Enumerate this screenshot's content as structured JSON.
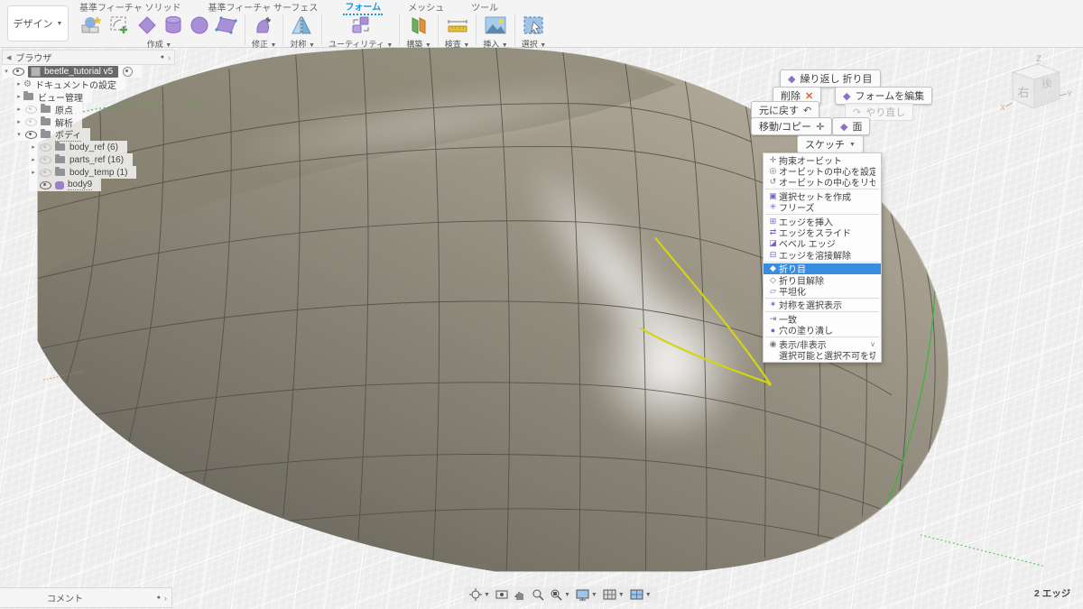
{
  "header": {
    "design_button": "デザイン",
    "tabs": [
      {
        "label": "基準フィーチャ ソリッド"
      },
      {
        "label": "基準フィーチャ サーフェス"
      },
      {
        "label": "フォーム"
      },
      {
        "label": "メッシュ"
      },
      {
        "label": "ツール"
      }
    ],
    "active_tab": "フォーム",
    "groups": [
      {
        "label": "作成"
      },
      {
        "label": "修正"
      },
      {
        "label": "対称"
      },
      {
        "label": "ユーティリティ"
      },
      {
        "label": "構築"
      },
      {
        "label": "検査"
      },
      {
        "label": "挿入"
      },
      {
        "label": "選択"
      }
    ]
  },
  "browser": {
    "title": "ブラウザ",
    "rows": [
      {
        "label": "beetle_tutorial v5"
      },
      {
        "label": "ドキュメントの設定"
      },
      {
        "label": "ビュー管理"
      },
      {
        "label": "原点"
      },
      {
        "label": "解析"
      },
      {
        "label": "ボディ"
      },
      {
        "label": "body_ref (6)"
      },
      {
        "label": "parts_ref (16)"
      },
      {
        "label": "body_temp (1)"
      },
      {
        "label": "body9"
      }
    ]
  },
  "marking_menu": {
    "repeat_crease": "繰り返し 折り目",
    "repeat_icon": "◆",
    "delete": "削除",
    "delete_icon": "✕",
    "edit_form": "フォームを編集",
    "edit_form_icon": "◆",
    "undo": "元に戻す",
    "undo_icon": "↶",
    "redo": "やり直し",
    "redo_icon": "↷",
    "move_copy": "移動/コピー",
    "move_icon": "✛",
    "face": "面",
    "face_icon": "◆",
    "sketch": "スケッチ"
  },
  "context_menu": {
    "items": [
      {
        "label": "拘束オービット",
        "glyph": "✛"
      },
      {
        "label": "オービットの中心を設定",
        "glyph": "◎"
      },
      {
        "label": "オービットの中心をリセット",
        "glyph": "↺"
      },
      {
        "label": "選択セットを作成",
        "glyph": "▣"
      },
      {
        "label": "フリーズ",
        "glyph": "✳"
      },
      {
        "label": "エッジを挿入",
        "glyph": "⊞"
      },
      {
        "label": "エッジをスライド",
        "glyph": "⇄"
      },
      {
        "label": "ベベル エッジ",
        "glyph": "◪"
      },
      {
        "label": "エッジを溶接解除",
        "glyph": "⊟"
      },
      {
        "label": "折り目",
        "glyph": "◆"
      },
      {
        "label": "折り目解除",
        "glyph": "◇"
      },
      {
        "label": "平坦化",
        "glyph": "▱"
      },
      {
        "label": "対称を選択表示",
        "glyph": "✶"
      },
      {
        "label": "一致",
        "glyph": "⇥"
      },
      {
        "label": "穴の塗り潰し",
        "glyph": "●"
      },
      {
        "label": "表示/非表示",
        "glyph": "◉"
      },
      {
        "label": "選択可能と選択不可を切り替え",
        "glyph": ""
      }
    ],
    "highlighted": "折り目",
    "submenu_chevron": "∨"
  },
  "viewcube": {
    "front": "右",
    "side": "後",
    "axis_x": "X",
    "axis_y": "Y",
    "axis_z": "Z"
  },
  "comment_panel": {
    "title": "コメント"
  },
  "statusbar": {
    "selection": "2 エッジ"
  },
  "ui": {
    "caret": "▼",
    "expand_open": "▾",
    "expand_closed": "▸",
    "collapse": "◀",
    "dot": "●",
    "chevron": "›"
  },
  "colors": {
    "accent": "#1e96d2",
    "menu_highlight": "#3a8dde",
    "selection_yellow": "#d4d414",
    "symmetry_green": "#3cb53c",
    "icon_purple": "#8b6fc9",
    "body_grey": "#8f8a7c"
  }
}
